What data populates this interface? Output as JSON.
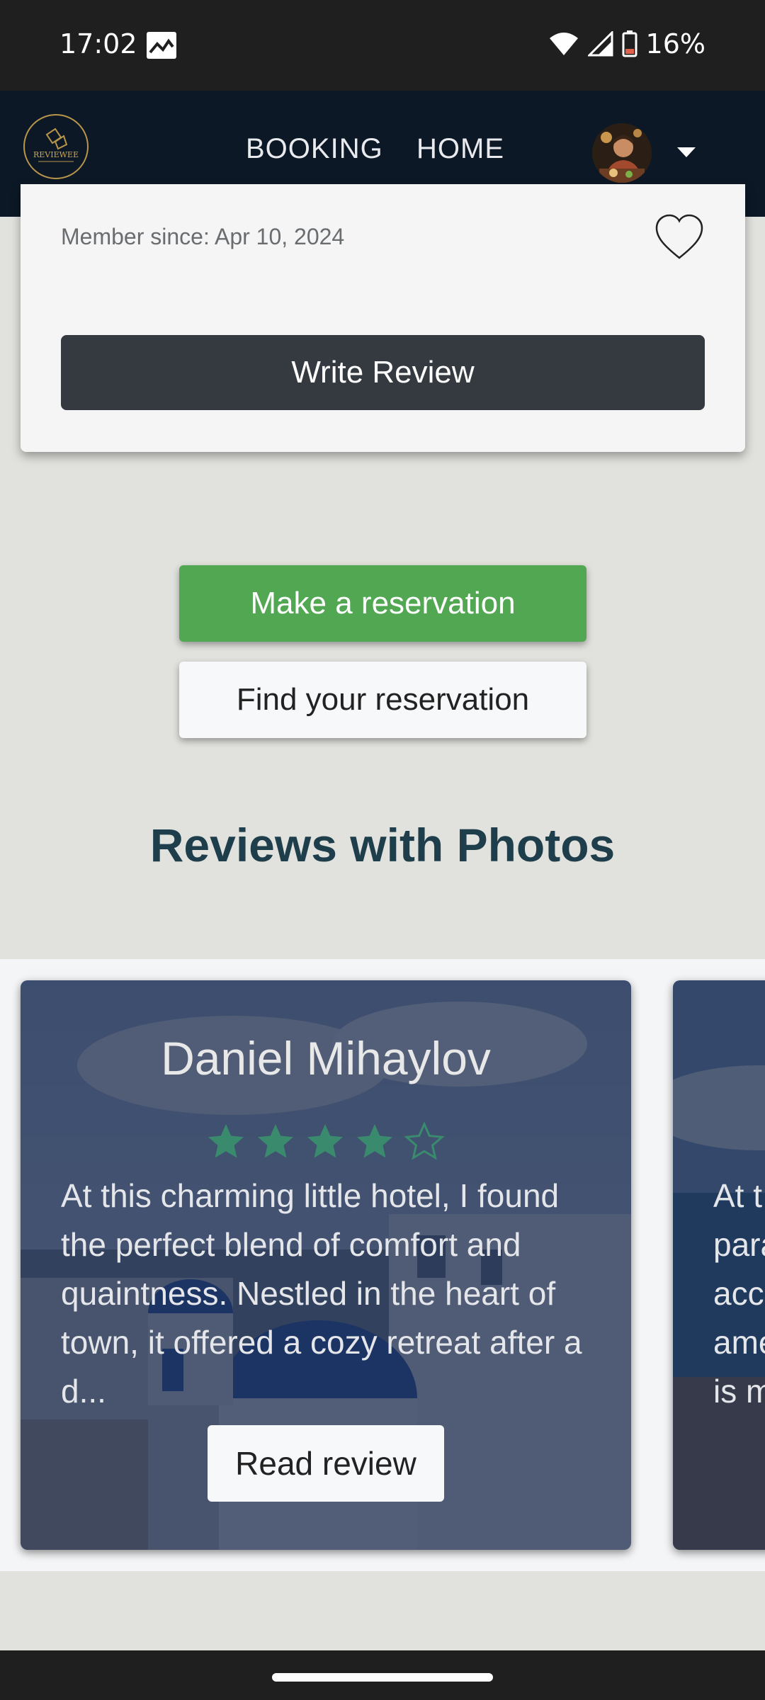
{
  "status_bar": {
    "time": "17:02",
    "battery": "16%",
    "icons": [
      "gallery-icon",
      "wifi-icon",
      "signal-icon",
      "battery-icon"
    ]
  },
  "nav": {
    "logo_text": "REVIEWEE",
    "links": [
      "BOOKING",
      "HOME"
    ],
    "avatar": "user-avatar",
    "menu_icon": "caret-down-icon"
  },
  "profile_card": {
    "member_since": "Member since: Apr 10, 2024",
    "write_review_label": "Write Review",
    "favorite_icon": "heart-icon"
  },
  "reservation": {
    "make_label": "Make a reservation",
    "find_label": "Find your reservation"
  },
  "reviews_section": {
    "title": "Reviews with Photos",
    "cards": [
      {
        "name": "Daniel Mihaylov",
        "rating": 4,
        "max_rating": 5,
        "text": "At this charming little hotel, I found the perfect blend of comfort and quaintness. Nestled in the heart of town, it offered a cozy retreat after a d...",
        "button_label": "Read review"
      },
      {
        "name": "",
        "text_partial": "At t\npara\nacco\name\nis m"
      }
    ]
  },
  "colors": {
    "nav_bg": "#0d1826",
    "accent_green": "#52a852",
    "star_color": "#3a8a6e",
    "title_color": "#1e3e4c",
    "dark_button": "#343a40"
  }
}
